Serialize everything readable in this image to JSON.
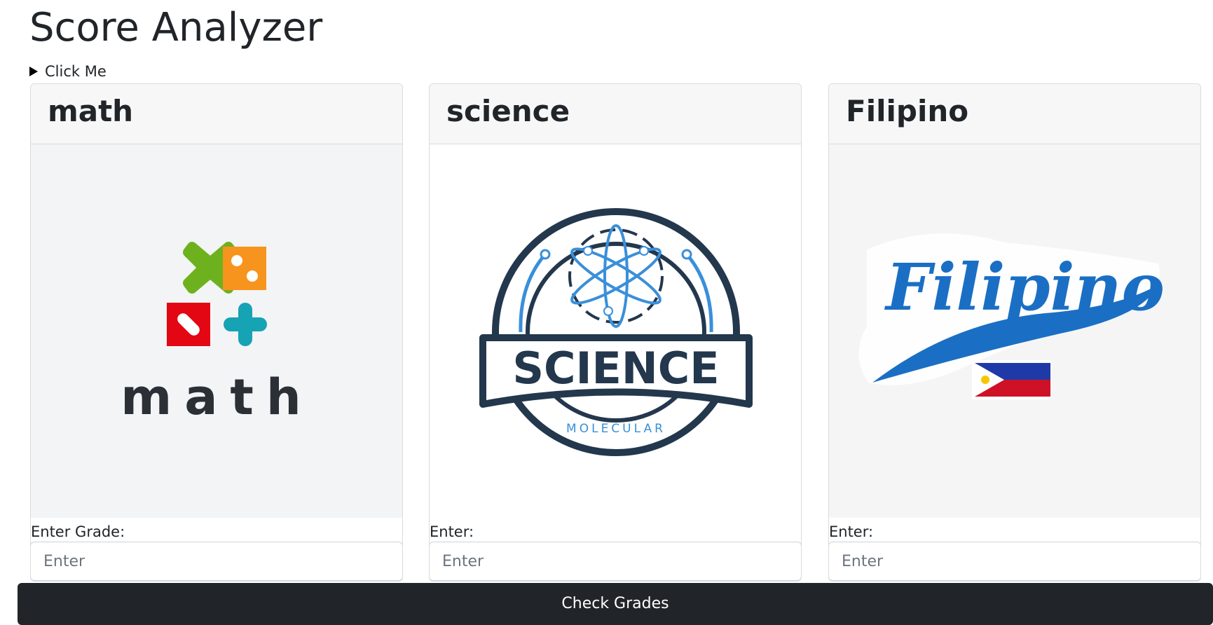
{
  "page": {
    "title": "Score Analyzer"
  },
  "details": {
    "summary": "Click Me"
  },
  "cards": [
    {
      "title": "math",
      "image_logo_text": "math",
      "label": "Enter Grade:",
      "placeholder": "Enter"
    },
    {
      "title": "science",
      "image_logo_text": "SCIENCE",
      "image_logo_subtext": "MOLECULAR",
      "label": "Enter:",
      "placeholder": "Enter"
    },
    {
      "title": "Filipino",
      "image_logo_text": "Filipino",
      "label": "Enter:",
      "placeholder": "Enter"
    }
  ],
  "actions": {
    "submit_label": "Check Grades"
  },
  "colors": {
    "button_bg": "#212529",
    "math_green": "#6db21e",
    "math_orange": "#f7941d",
    "math_red": "#e30613",
    "math_teal": "#16a3b4",
    "science_navy": "#23374d",
    "science_blue": "#3a8fd9",
    "filipino_blue": "#1a6fc4",
    "flag_blue": "#1f3aa8",
    "flag_red": "#ce1126",
    "flag_yellow": "#f6c600"
  }
}
